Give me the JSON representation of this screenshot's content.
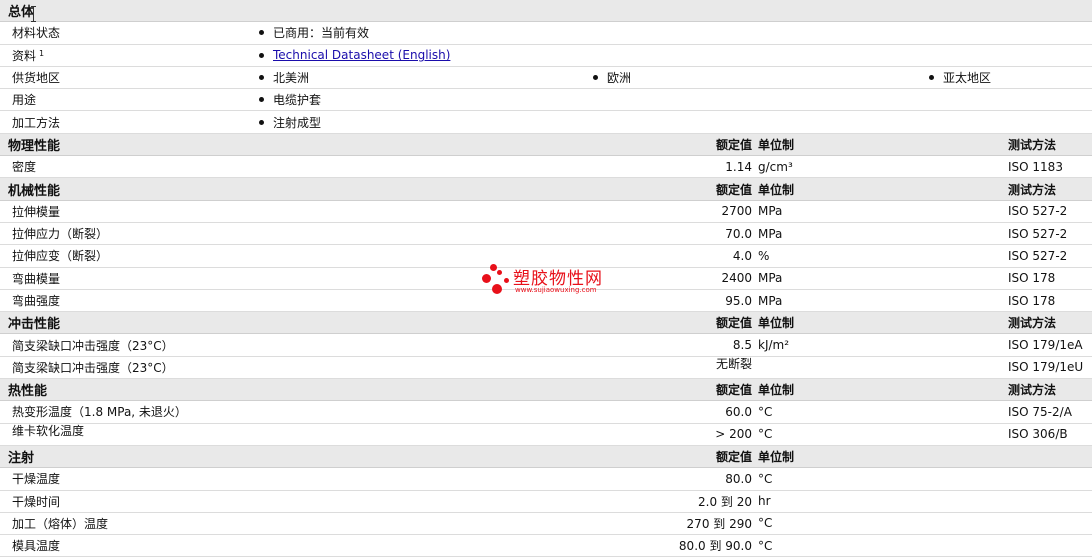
{
  "general": {
    "title": "总体",
    "status_label": "材料状态",
    "status_value": "已商用：当前有效",
    "docs_label": "资料",
    "docs_sup": "1",
    "docs_link": "Technical Datasheet (English)",
    "supply_label": "供货地区",
    "supply_regions": [
      "北美洲",
      "欧洲",
      "亚太地区"
    ],
    "use_label": "用途",
    "use_value": "电缆护套",
    "process_label": "加工方法",
    "process_value": "注射成型"
  },
  "columns": {
    "value": "额定值",
    "unit": "单位制",
    "method": "测试方法"
  },
  "physical": {
    "title": "物理性能",
    "rows": [
      {
        "name": "密度",
        "value": "1.14",
        "unit": "g/cm³",
        "method": "ISO 1183"
      }
    ]
  },
  "mechanical": {
    "title": "机械性能",
    "rows": [
      {
        "name": "拉伸模量",
        "value": "2700",
        "unit": "MPa",
        "method": "ISO 527-2"
      },
      {
        "name": "拉伸应力（断裂）",
        "value": "70.0",
        "unit": "MPa",
        "method": "ISO 527-2"
      },
      {
        "name": "拉伸应变（断裂）",
        "value": "4.0",
        "unit": "%",
        "method": "ISO 527-2"
      },
      {
        "name": "弯曲模量",
        "value": "2400",
        "unit": "MPa",
        "method": "ISO 178"
      },
      {
        "name": "弯曲强度",
        "value": "95.0",
        "unit": "MPa",
        "method": "ISO 178"
      }
    ]
  },
  "impact": {
    "title": "冲击性能",
    "rows": [
      {
        "name": "简支梁缺口冲击强度（23°C）",
        "value": "8.5",
        "unit": "kJ/m²",
        "method": "ISO 179/1eA"
      },
      {
        "name": "简支梁缺口冲击强度（23°C）",
        "value": "无断裂",
        "unit": "",
        "method": "ISO 179/1eU"
      }
    ]
  },
  "thermal": {
    "title": "热性能",
    "rows": [
      {
        "name": "热变形温度（1.8 MPa, 未退火）",
        "value": "60.0",
        "unit": "°C",
        "method": "ISO 75-2/A"
      },
      {
        "name": "维卡软化温度",
        "value": "> 200",
        "unit": "°C",
        "method": "ISO 306/B"
      }
    ]
  },
  "injection": {
    "title": "注射",
    "rows": [
      {
        "name": "干燥温度",
        "value": "80.0",
        "unit": "°C",
        "method": ""
      },
      {
        "name": "干燥时间",
        "value": "2.0 到  20",
        "unit": "hr",
        "method": ""
      },
      {
        "name": "加工（熔体）温度",
        "value": "270 到  290",
        "unit": "°C",
        "method": ""
      },
      {
        "name": "模具温度",
        "value": "80.0 到  90.0",
        "unit": "°C",
        "method": ""
      }
    ]
  },
  "watermark": {
    "name": "塑胶物性网",
    "url": "www.sujiaowuxing.com",
    "color": "#e8101a"
  }
}
